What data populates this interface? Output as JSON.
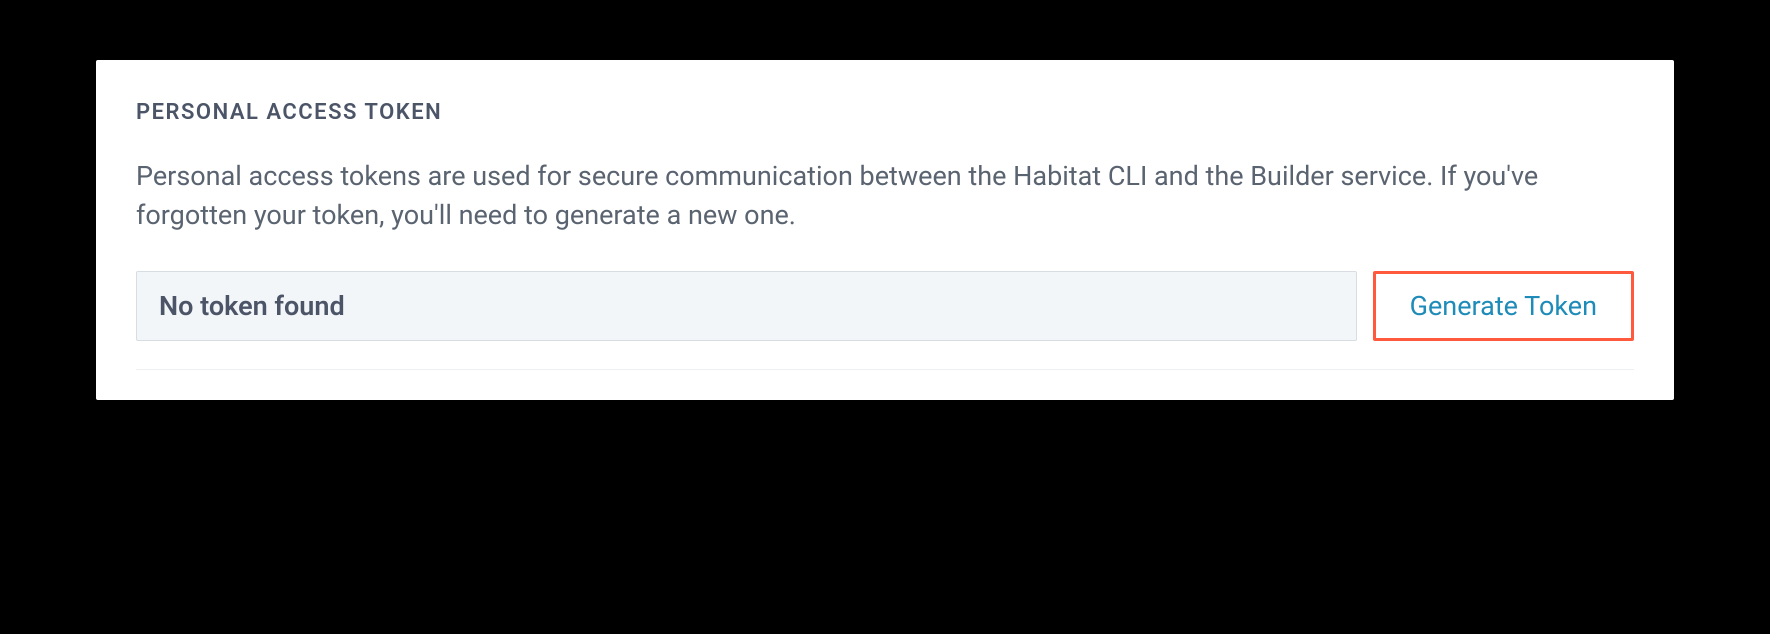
{
  "section": {
    "title": "PERSONAL ACCESS TOKEN",
    "description": "Personal access tokens are used for secure communication between the Habitat CLI and the Builder service. If you've forgotten your token, you'll need to generate a new one."
  },
  "token": {
    "value": "No token found"
  },
  "actions": {
    "generate_label": "Generate Token"
  }
}
